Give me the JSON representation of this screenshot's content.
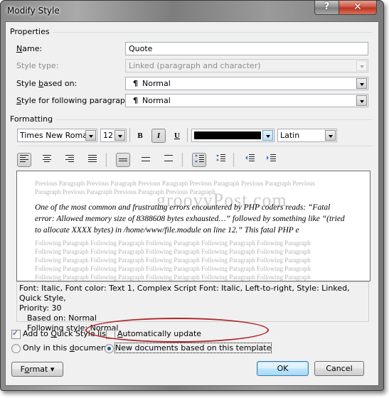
{
  "window": {
    "title": "Modify Style",
    "help_glyph": "?",
    "close_glyph": "✕"
  },
  "properties": {
    "section_label": "Properties",
    "name_label": "Name:",
    "name_value": "Quote",
    "style_type_label": "Style type:",
    "style_type_value": "Linked (paragraph and character)",
    "based_on_label": "Style based on:",
    "based_on_value": "Normal",
    "following_label": "Style for following paragraph:",
    "following_value": "Normal",
    "pilcrow": "¶"
  },
  "formatting": {
    "section_label": "Formatting",
    "font_name": "Times New Roman",
    "font_size": "12",
    "bold_glyph": "B",
    "italic_glyph": "I",
    "underline_glyph": "U",
    "font_color": "#000000",
    "script": "Latin",
    "italic_active": true
  },
  "preview": {
    "previous_line1": "Previous Paragraph Previous Paragraph Previous Paragraph Previous Paragraph Previous Paragraph Previous",
    "previous_line2": "Paragraph Previous Paragraph Previous Paragraph Previous Paragraph",
    "sample_text": "One of the most common and frustrating errors encountered by PHP coders reads: “Fatal error: Allowed memory size of 8388608 bytes exhausted…” followed by something like “(tried to allocate XXXX bytes) in /home/www/file.module on line 12.” This fatal PHP e",
    "following_line": "Following Paragraph Following Paragraph Following Paragraph Following Paragraph Following Paragraph",
    "watermark": "groovyPost.com"
  },
  "description": {
    "line1": "Font: Italic, Font color: Text 1, Complex Script Font: Italic, Left-to-right, Style: Linked, Quick Style,",
    "line2": "Priority: 30",
    "line3": "Based on: Normal",
    "line4": "Following style: Normal"
  },
  "options": {
    "add_quick_style": {
      "label": "Add to Quick Style list",
      "checked": true
    },
    "auto_update": {
      "label": "Automatically update",
      "checked": false
    },
    "only_this_doc": {
      "label": "Only in this document",
      "selected": false
    },
    "new_docs_template": {
      "label": "New documents based on this template",
      "selected": true
    }
  },
  "buttons": {
    "format": "Format",
    "format_arrow": "▾",
    "ok": "OK",
    "cancel": "Cancel"
  },
  "colors": {
    "annotation_ellipse": "#b2262a",
    "close_button": "#c9503c",
    "default_button_border": "#3c7fb1"
  }
}
